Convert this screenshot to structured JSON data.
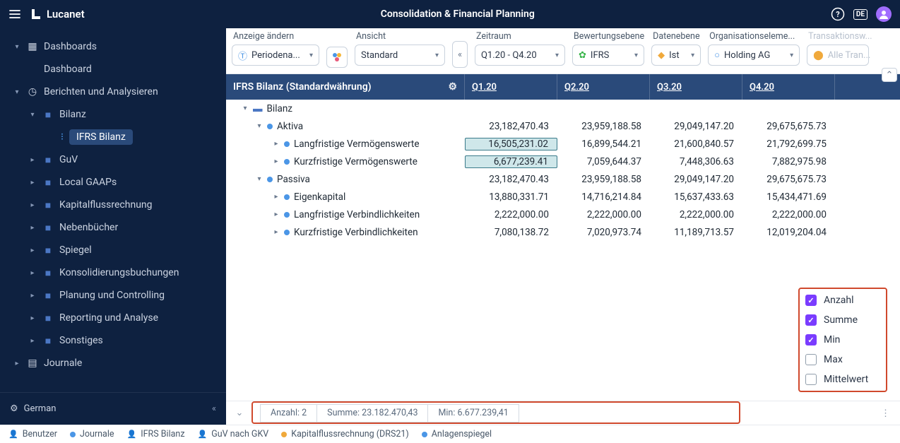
{
  "topbar": {
    "brand": "Lucanet",
    "title": "Consolidation & Financial Planning",
    "lang_code": "DE"
  },
  "sidebar": {
    "items": [
      {
        "label": "Dashboards",
        "children": [
          {
            "label": "Dashboard"
          }
        ]
      },
      {
        "label": "Berichten und Analysieren",
        "children": [
          {
            "label": "Bilanz",
            "children": [
              {
                "label": "IFRS Bilanz",
                "active": true
              }
            ]
          },
          {
            "label": "GuV"
          },
          {
            "label": "Local GAAPs"
          },
          {
            "label": "Kapitalflussrechnung"
          },
          {
            "label": "Nebenbücher"
          },
          {
            "label": "Spiegel"
          },
          {
            "label": "Konsolidierungsbuchungen"
          },
          {
            "label": "Planung und Controlling"
          },
          {
            "label": "Reporting und Analyse"
          },
          {
            "label": "Sonstiges"
          }
        ]
      },
      {
        "label": "Journale"
      }
    ],
    "language": "German"
  },
  "filters": {
    "anzeige": {
      "label": "Anzeige ändern",
      "value": "Periodena..."
    },
    "ansicht": {
      "label": "Ansicht",
      "value": "Standard"
    },
    "zeitraum": {
      "label": "Zeitraum",
      "value": "Q1.20 - Q4.20"
    },
    "bewertung": {
      "label": "Bewertungsebene",
      "value": "IFRS"
    },
    "daten": {
      "label": "Datenebene",
      "value": "Ist"
    },
    "org": {
      "label": "Organisationseleme...",
      "value": "Holding AG"
    },
    "trans": {
      "label": "Transaktionsw...",
      "value": "Alle Tran..."
    }
  },
  "table": {
    "title": "IFRS Bilanz (Standardwährung)",
    "cols": [
      "Q1.20",
      "Q2.20",
      "Q3.20",
      "Q4.20"
    ],
    "rows": [
      {
        "label": "Bilanz",
        "indent": 1,
        "type": "folder",
        "chev": "down",
        "vals": [
          "",
          "",
          "",
          ""
        ]
      },
      {
        "label": "Aktiva",
        "indent": 2,
        "type": "node",
        "chev": "down",
        "vals": [
          "23,182,470.43",
          "23,959,188.58",
          "29,049,147.20",
          "29,675,675.73"
        ]
      },
      {
        "label": "Langfristige Vermögenswerte",
        "indent": 3,
        "type": "node",
        "chev": "right",
        "vals": [
          "16,505,231.02",
          "16,899,544.21",
          "21,600,840.57",
          "21,792,699.75"
        ],
        "sel1": true
      },
      {
        "label": "Kurzfristige Vermögenswerte",
        "indent": 3,
        "type": "node",
        "chev": "right",
        "vals": [
          "6,677,239.41",
          "7,059,644.37",
          "7,448,306.63",
          "7,882,975.98"
        ],
        "sel1": true
      },
      {
        "label": "Passiva",
        "indent": 2,
        "type": "node",
        "chev": "down",
        "vals": [
          "23,182,470.43",
          "23,959,188.58",
          "29,049,147.20",
          "29,675,675.73"
        ]
      },
      {
        "label": "Eigenkapital",
        "indent": 3,
        "type": "node",
        "chev": "right",
        "vals": [
          "13,880,331.71",
          "14,716,214.84",
          "15,637,433.63",
          "15,434,471.69"
        ]
      },
      {
        "label": "Langfristige Verbindlichkeiten",
        "indent": 3,
        "type": "node",
        "chev": "right",
        "vals": [
          "2,222,000.00",
          "2,222,000.00",
          "2,222,000.00",
          "2,222,000.00"
        ]
      },
      {
        "label": "Kurzfristige Verbindlichkeiten",
        "indent": 3,
        "type": "node",
        "chev": "right",
        "vals": [
          "7,080,138.72",
          "7,020,973.74",
          "11,189,713.57",
          "12,019,204.04"
        ]
      }
    ]
  },
  "popup": {
    "items": [
      {
        "label": "Anzahl",
        "checked": true
      },
      {
        "label": "Summe",
        "checked": true
      },
      {
        "label": "Min",
        "checked": true
      },
      {
        "label": "Max",
        "checked": false
      },
      {
        "label": "Mittelwert",
        "checked": false
      }
    ]
  },
  "status": {
    "anzahl_label": "Anzahl:",
    "anzahl": "2",
    "summe_label": "Summe:",
    "summe": "23.182.470,43",
    "min_label": "Min:",
    "min": "6.677.239,41"
  },
  "breadcrumbs": [
    {
      "label": "Benutzer",
      "color": "#8a97a8"
    },
    {
      "label": "Journale",
      "color": "#4b96e6"
    },
    {
      "label": "IFRS Bilanz",
      "color": "#8a97a8"
    },
    {
      "label": "GuV nach GKV",
      "color": "#8a97a8"
    },
    {
      "label": "Kapitalflussrechnung (DRS21)",
      "color": "#f0a93b"
    },
    {
      "label": "Anlagenspiegel",
      "color": "#4b96e6"
    }
  ]
}
